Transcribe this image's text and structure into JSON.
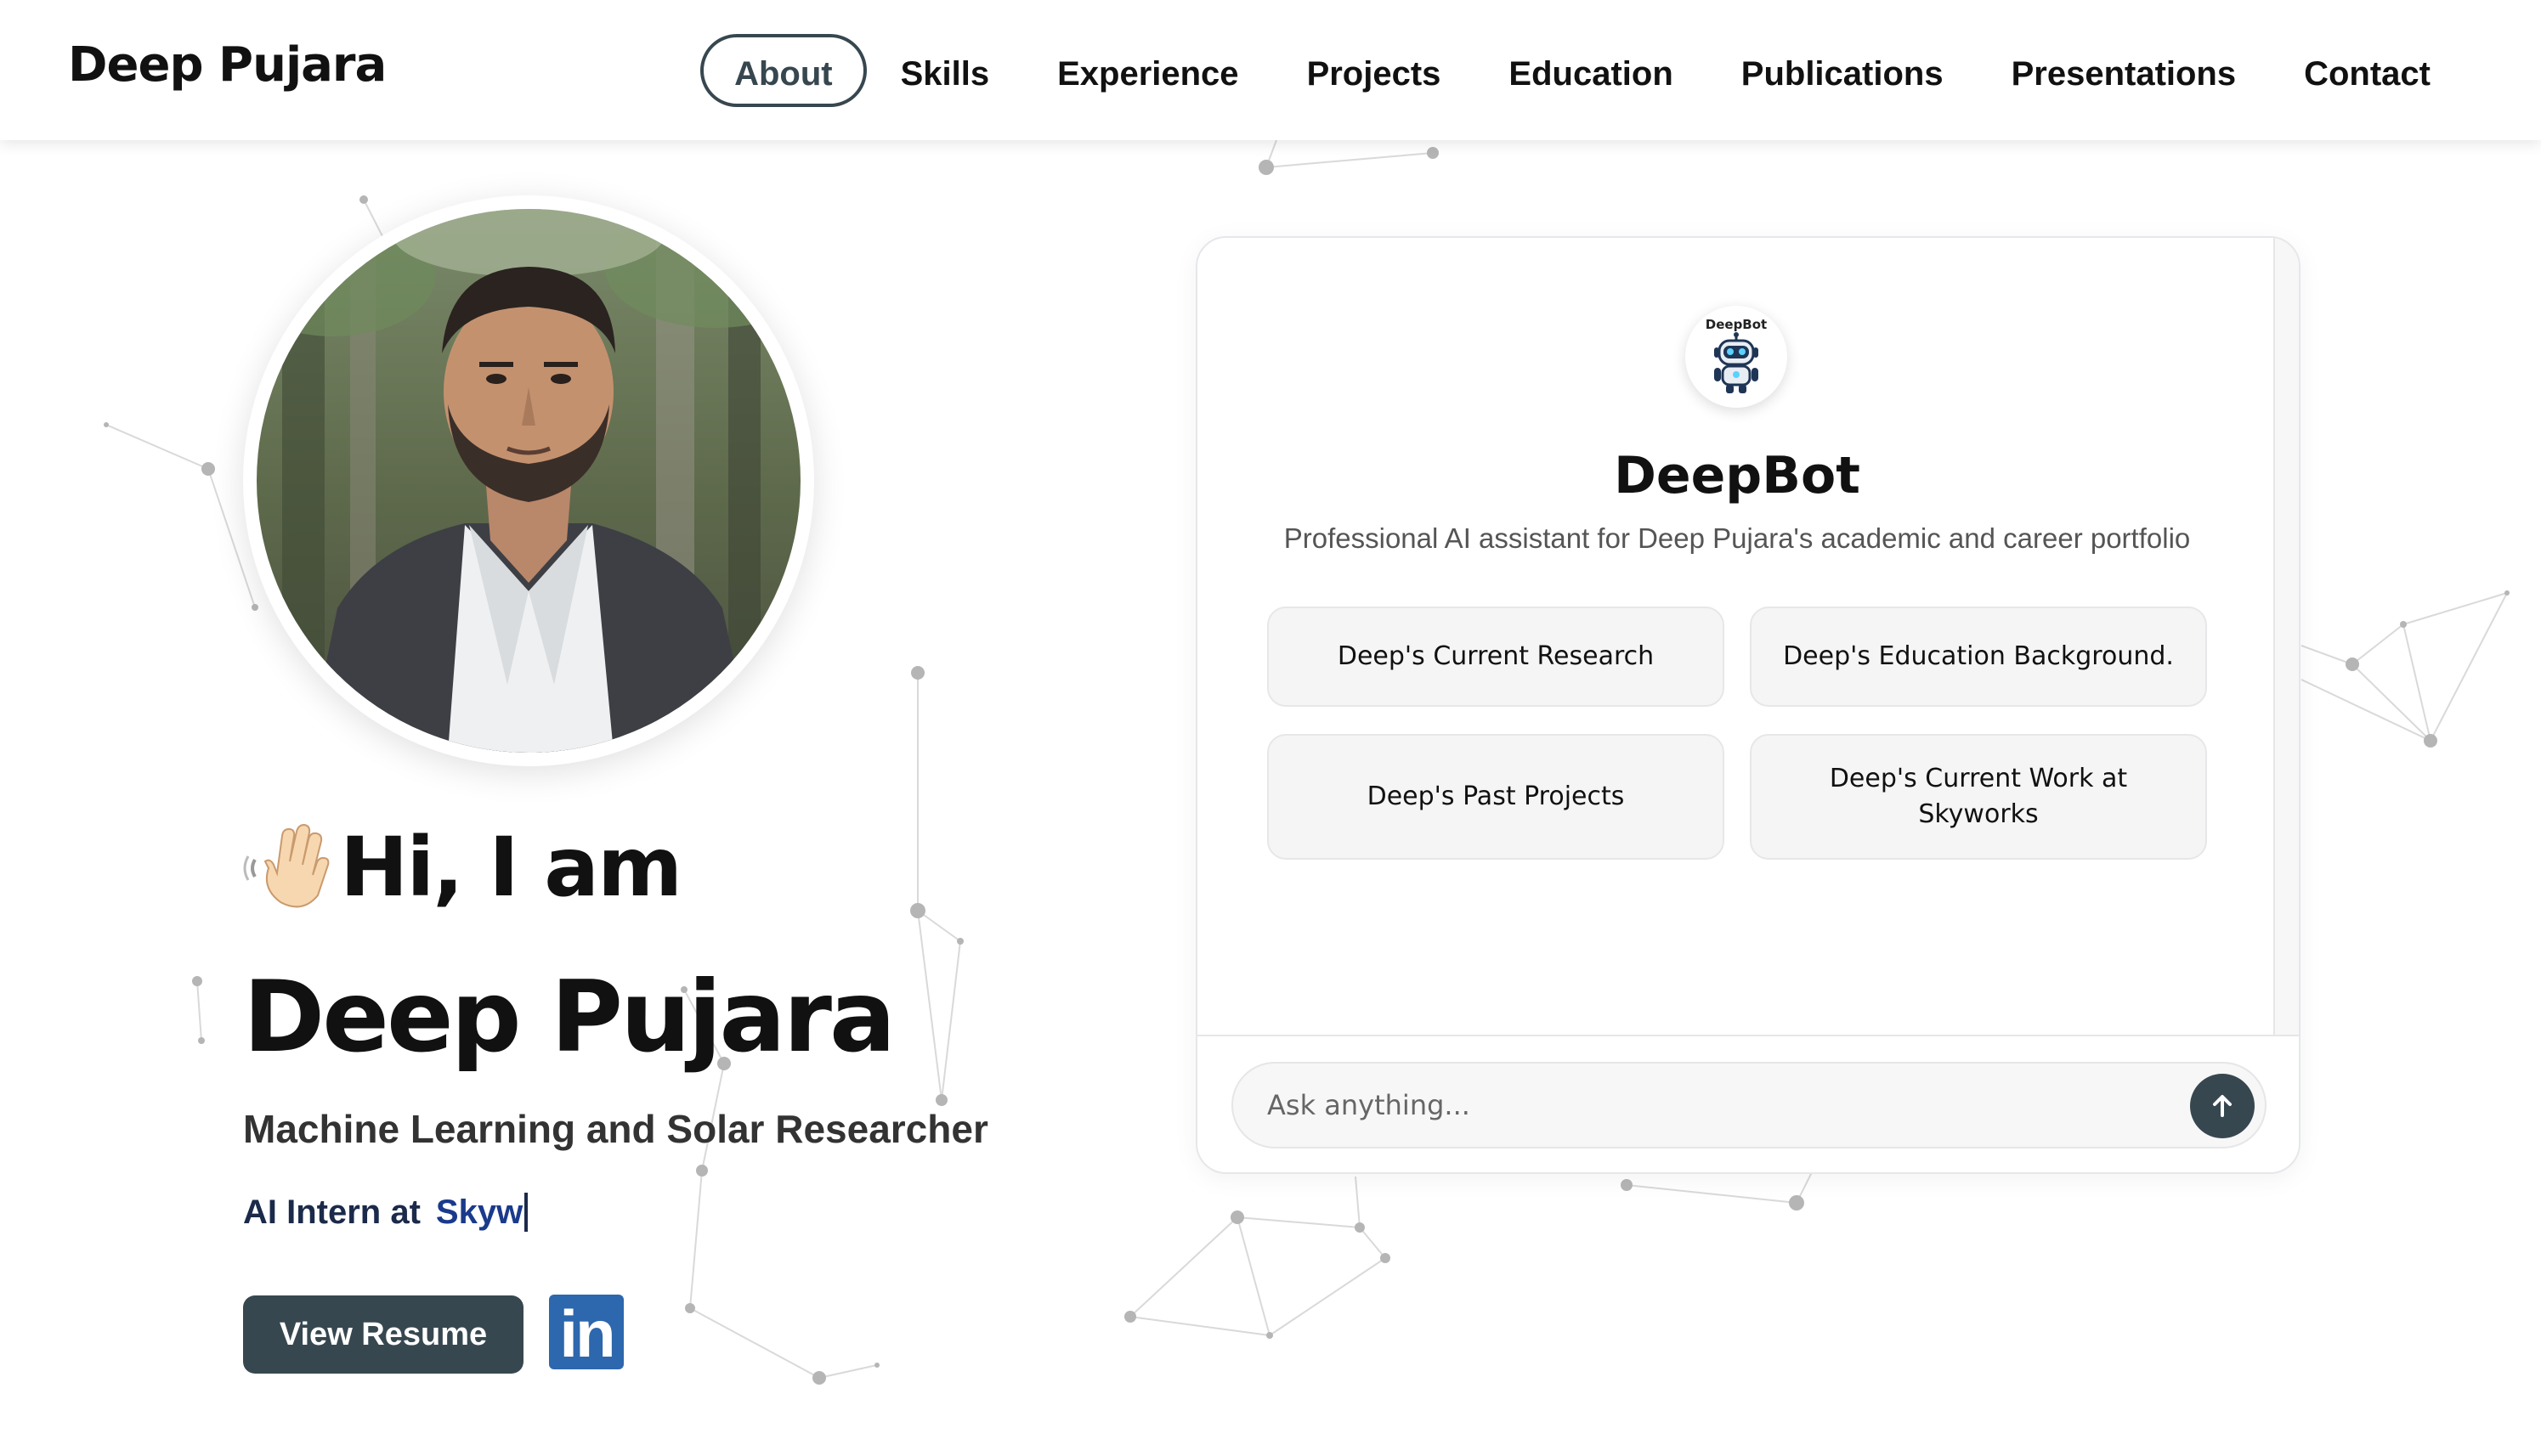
{
  "nav": {
    "brand": "Deep Pujara",
    "links": [
      {
        "label": "About",
        "active": true
      },
      {
        "label": "Skills"
      },
      {
        "label": "Experience"
      },
      {
        "label": "Projects"
      },
      {
        "label": "Education"
      },
      {
        "label": "Publications"
      },
      {
        "label": "Presentations"
      },
      {
        "label": "Contact"
      }
    ]
  },
  "hero": {
    "greeting": "Hi, I am",
    "name": "Deep Pujara",
    "role": "Machine Learning and Solar Researcher",
    "typed_prefix": "AI Intern at",
    "typed_company": "Skyw",
    "resume_button": "View Resume",
    "linkedin_text": "in"
  },
  "chatbot": {
    "avatar_label": "DeepBot",
    "title": "DeepBot",
    "subtitle": "Professional AI assistant for Deep Pujara's academic and career portfolio",
    "suggestions": [
      "Deep's Current Research",
      "Deep's Education Background.",
      "Deep's Past Projects",
      "Deep's Current Work at Skyworks"
    ],
    "input_placeholder": "Ask anything..."
  },
  "colors": {
    "accent_dark": "#37474f",
    "linkedin_blue": "#2d67ad",
    "typed_text": "#1b2a4a",
    "network_gray": "#b5b5b5"
  },
  "icons": {
    "greeting": "waving-hand-icon",
    "send": "arrow-up-icon",
    "avatar": "robot-icon",
    "social": "linkedin-icon"
  }
}
